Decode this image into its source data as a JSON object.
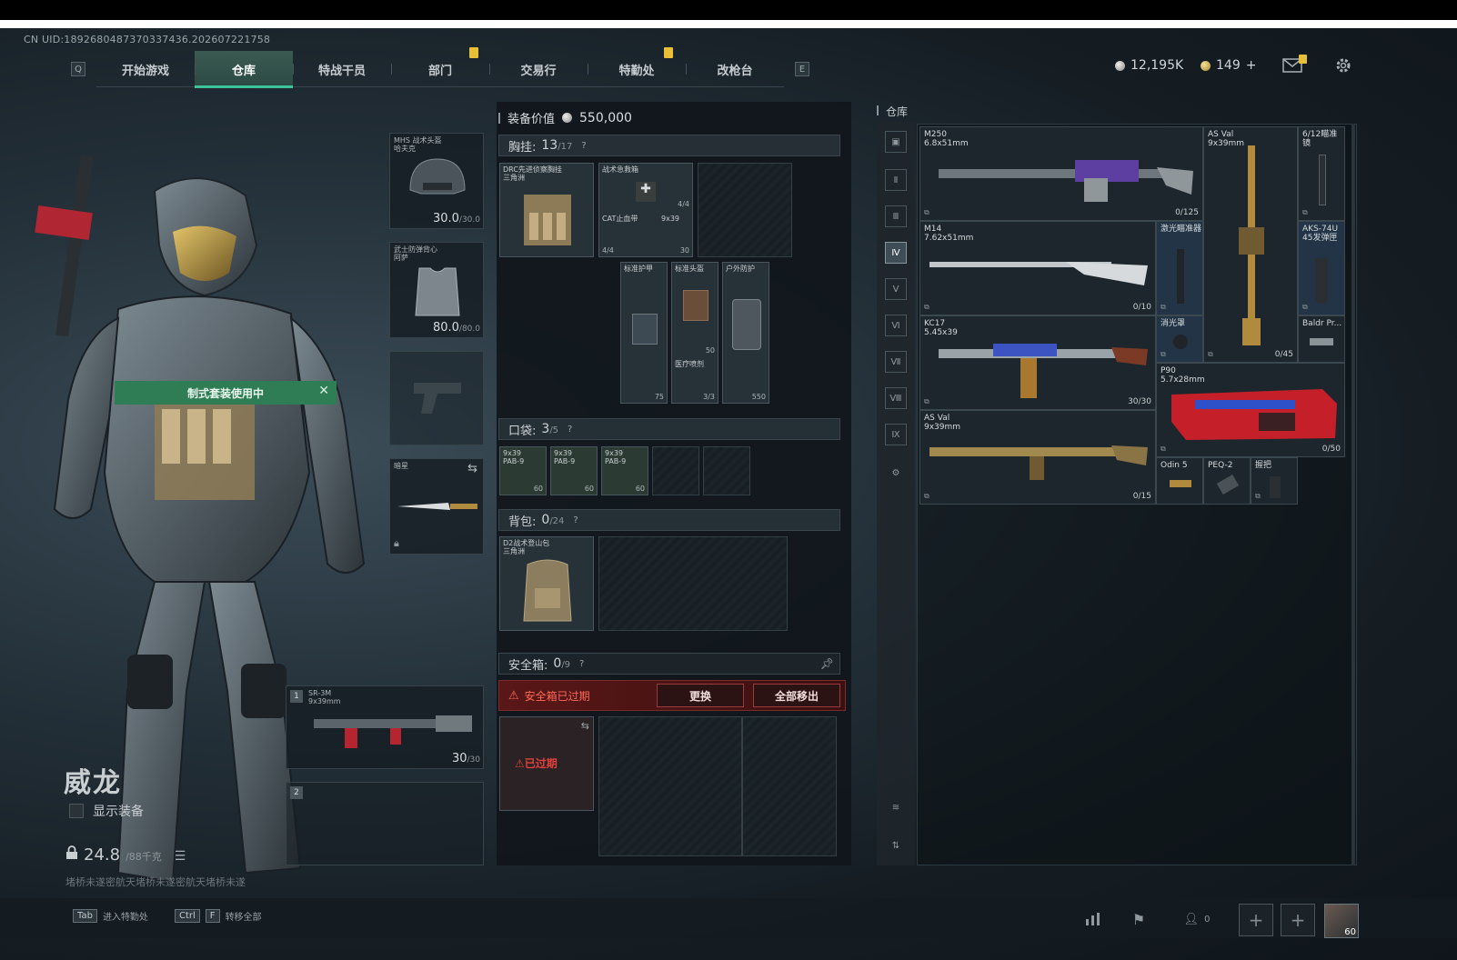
{
  "uid": "CN UID:18926804873703374​36.202607221758",
  "nav": {
    "left_key": "Q",
    "right_key": "E",
    "tabs": [
      "开始游戏",
      "仓库",
      "特战干员",
      "部门",
      "交易行",
      "特勤处",
      "改枪台"
    ],
    "active_tab": "仓库"
  },
  "currency": {
    "silver": "12,195K",
    "gold": "149",
    "gold_plus": "+"
  },
  "character": {
    "suit_banner": "制式套装使用中",
    "operator_name": "威龙",
    "show_gear_label": "显示装备",
    "weight_value": "24.8",
    "weight_max": "/88千克",
    "motto": "堵桥未遂密航天堵桥未遂密航天堵桥未遂"
  },
  "equipment": {
    "helmet": {
      "name": "MHS 战术头盔",
      "sub": "哈夫克",
      "value": "30.0",
      "max": "/30.0"
    },
    "armor": {
      "name": "武士防弹背心",
      "sub": "阿萨",
      "value": "80.0",
      "max": "/80.0"
    },
    "melee": {
      "name": "暗星"
    },
    "primary": {
      "slot": "1",
      "name": "SR-3M",
      "caliber": "9x39mm",
      "ammo": "30",
      "ammo_max": "/30"
    },
    "secondary": {
      "slot": "2"
    }
  },
  "loadout": {
    "value_label": "装备价值",
    "value": "550,000",
    "chest": {
      "label": "胸挂:",
      "count": "13",
      "max": "/17",
      "q": "?"
    },
    "chest_rig": {
      "name": "DRC先进侦察胸挂",
      "sub": "三角洲"
    },
    "chest_items": [
      {
        "name": "战术急救箱",
        "num": "4/4"
      },
      {
        "name": "CAT止血带",
        "num": "4/4"
      },
      {
        "name": "9x39",
        "num": "30"
      }
    ],
    "armor_slots": [
      {
        "name": "标准护甲",
        "num": "75"
      },
      {
        "name": "标准头盔",
        "num": "50"
      },
      {
        "name": "户外防护",
        "num": "550"
      }
    ],
    "armor_sub": {
      "name": "医疗喷剂",
      "num": "3/3"
    },
    "pocket": {
      "label": "口袋:",
      "count": "3",
      "max": "/5",
      "q": "?"
    },
    "pocket_items": [
      {
        "name": "9x39\nPAB-9",
        "num": "60"
      },
      {
        "name": "9x39\nPAB-9",
        "num": "60"
      },
      {
        "name": "9x39\nPAB-9",
        "num": "60"
      }
    ],
    "backpack": {
      "label": "背包:",
      "count": "0",
      "max": "/24",
      "q": "?"
    },
    "backpack_item": {
      "name": "D2战术登山包",
      "sub": "三角洲"
    },
    "safebox": {
      "label": "安全箱:",
      "count": "0",
      "max": "/9",
      "q": "?"
    },
    "warning": "安全箱已过期",
    "replace_label": "更换",
    "remove_all_label": "全部移出",
    "expired_stamp": "已过期"
  },
  "warehouse": {
    "title": "仓库",
    "weapons": [
      {
        "name": "M250",
        "caliber": "6.8x51mm",
        "count": "0/125"
      },
      {
        "name": "AS Val",
        "caliber": "9x39mm",
        "count": "0/45"
      },
      {
        "name": "6/12瞄准镜",
        "caliber": "",
        "count": ""
      },
      {
        "name": "M14",
        "caliber": "7.62x51mm",
        "count": "0/10"
      },
      {
        "name": "激光瞄准器",
        "caliber": "",
        "count": ""
      },
      {
        "name": "AKS-74U",
        "caliber": "45发弹匣",
        "count": ""
      },
      {
        "name": "KC17",
        "caliber": "5.45x39",
        "count": "30/30"
      },
      {
        "name": "消光罩",
        "caliber": "",
        "count": ""
      },
      {
        "name": "Baldr Pr...",
        "caliber": "",
        "count": ""
      },
      {
        "name": "P90",
        "caliber": "5.7x28mm",
        "count": "0/50"
      },
      {
        "name": "AS Val",
        "caliber": "9x39mm",
        "count": "0/15"
      },
      {
        "name": "Odin 5",
        "caliber": "",
        "count": ""
      },
      {
        "name": "PEQ-2",
        "caliber": "",
        "count": ""
      },
      {
        "name": "握把",
        "caliber": "",
        "count": ""
      }
    ]
  },
  "bottom": {
    "hint1_key": "Tab",
    "hint1": "进入特勤处",
    "hint2_key1": "Ctrl",
    "hint2_key2": "F",
    "hint2": "转移全部",
    "squad_count": "0",
    "player_level": "60"
  },
  "colors": {
    "accent": "#3ec29a",
    "warning": "#ff6a5a",
    "banner": "#2f7d55"
  }
}
